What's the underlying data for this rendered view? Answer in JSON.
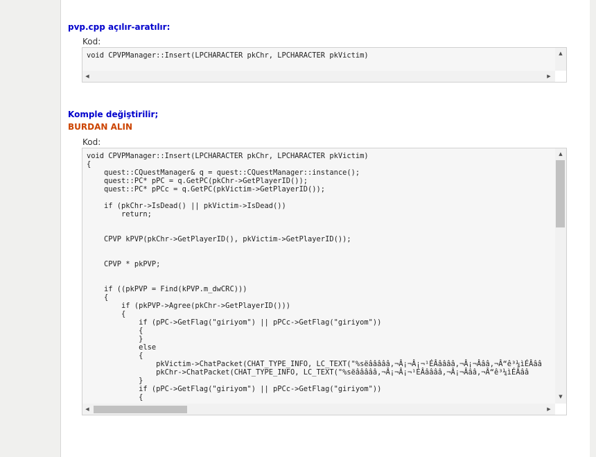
{
  "section_divider": "-------------------------",
  "search_section": {
    "title": "pvp.cpp açılır-aratılır:",
    "code_label": "Kod:",
    "code": "void CPVPManager::Insert(LPCHARACTER pkChr, LPCHARACTER pkVictim)"
  },
  "replace_section": {
    "title": "Komple değiştirilir;",
    "subtitle": "BURDAN ALIN",
    "code_label": "Kod:",
    "code": "void CPVPManager::Insert(LPCHARACTER pkChr, LPCHARACTER pkVictim)\n{\n    quest::CQuestManager& q = quest::CQuestManager::instance();\n    quest::PC* pPC = q.GetPC(pkChr->GetPlayerID());\n    quest::PC* pPCc = q.GetPC(pkVictim->GetPlayerID());\n\n    if (pkChr->IsDead() || pkVictim->IsDead())\n        return;\n\n\n    CPVP kPVP(pkChr->GetPlayerID(), pkVictim->GetPlayerID());\n\n\n    CPVP * pkPVP;\n\n\n    if ((pkPVP = Find(kPVP.m_dwCRC)))\n    {\n        if (pkPVP->Agree(pkChr->GetPlayerID()))\n        {\n            if (pPC->GetFlag(\"giriyom\") || pPCc->GetFlag(\"giriyom\"))\n            {\n            }\n            else\n            {\n                pkVictim->ChatPacket(CHAT_TYPE_INFO, LC_TEXT(\"%sëâââââ,¬Â¡¬Â¡¬¹ÉÂââââ,¬Â¡¬Âââ,¬Â“ê³¼ìÉÂââ\n                pkChr->ChatPacket(CHAT_TYPE_INFO, LC_TEXT(\"%sëâââââ,¬Â¡¬Â¡¬¹ÉÂââââ,¬Â¡¬Âââ,¬Â“ê³¼ìÉÂââ\n            }\n            if (pPC->GetFlag(\"giriyom\") || pPCc->GetFlag(\"giriyom\"))\n            {"
  }
}
